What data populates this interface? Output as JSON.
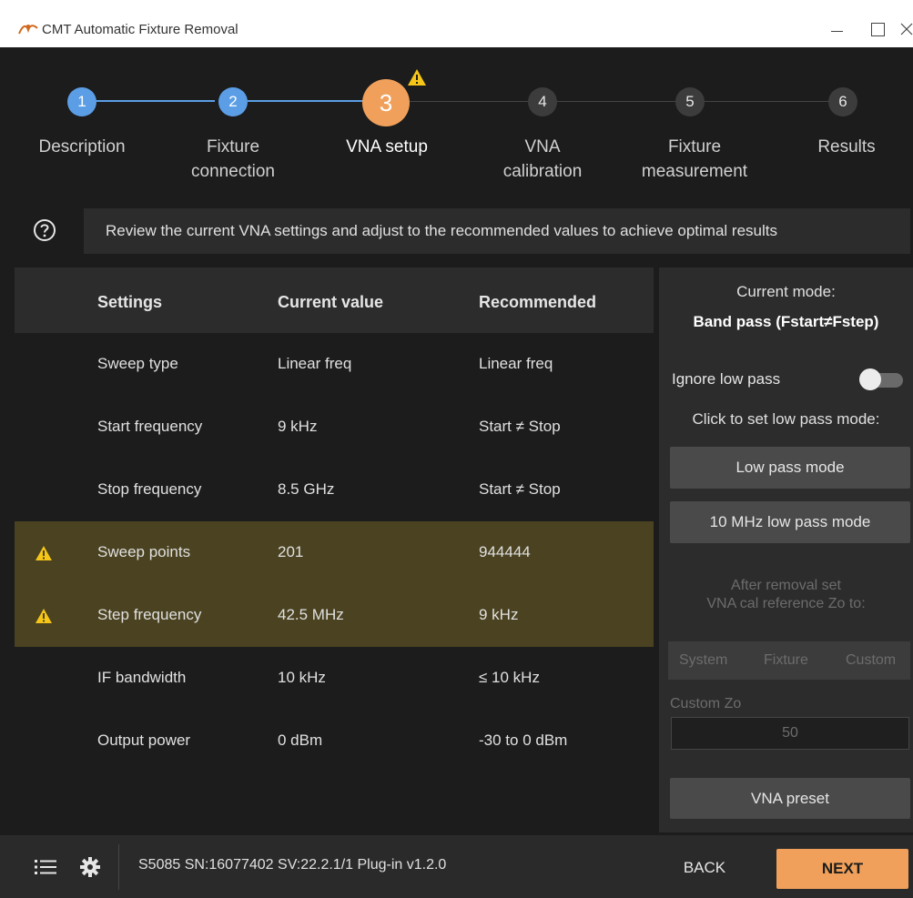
{
  "window": {
    "title": "CMT Automatic Fixture Removal",
    "app_icon": "cmt-logo-icon",
    "controls": [
      "minimize-icon",
      "maximize-icon",
      "close-icon"
    ]
  },
  "stepper": {
    "steps": [
      {
        "number": "1",
        "label_line1": "Description",
        "label_line2": "",
        "state": "done"
      },
      {
        "number": "2",
        "label_line1": "Fixture",
        "label_line2": "connection",
        "state": "done"
      },
      {
        "number": "3",
        "label_line1": "VNA setup",
        "label_line2": "",
        "state": "active"
      },
      {
        "number": "4",
        "label_line1": "VNA",
        "label_line2": "calibration",
        "state": "todo"
      },
      {
        "number": "5",
        "label_line1": "Fixture",
        "label_line2": "measurement",
        "state": "todo"
      },
      {
        "number": "6",
        "label_line1": "Results",
        "label_line2": "",
        "state": "todo"
      }
    ],
    "active_warning_icon": "warning-icon"
  },
  "info": {
    "icon": "help-icon",
    "text": "Review the current VNA settings and adjust to the recommended values to achieve optimal results"
  },
  "table": {
    "headers": {
      "settings": "Settings",
      "current": "Current value",
      "recommended": "Recommended"
    },
    "rows": [
      {
        "setting": "Sweep type",
        "current": "Linear freq",
        "recommended": "Linear freq",
        "warning": false
      },
      {
        "setting": "Start frequency",
        "current": "9 kHz",
        "recommended": "Start ≠ Stop",
        "warning": false
      },
      {
        "setting": "Stop frequency",
        "current": "8.5 GHz",
        "recommended": "Start ≠ Stop",
        "warning": false
      },
      {
        "setting": "Sweep points",
        "current": "201",
        "recommended": "944444",
        "warning": true
      },
      {
        "setting": "Step frequency",
        "current": "42.5 MHz",
        "recommended": "9 kHz",
        "warning": true
      },
      {
        "setting": "IF bandwidth",
        "current": "10 kHz",
        "recommended": "≤ 10 kHz",
        "warning": false
      },
      {
        "setting": "Output power",
        "current": "0 dBm",
        "recommended": "-30 to 0 dBm",
        "warning": false
      }
    ],
    "colors": {
      "warning_row": "#4a4220",
      "warning_icon": "#f5c518"
    }
  },
  "panel": {
    "mode_title": "Current mode:",
    "mode_value": "Band pass (Fstart≠Fstep)",
    "ignore_low_pass_label": "Ignore low pass",
    "ignore_low_pass_on": false,
    "click_label": "Click to set low pass mode:",
    "low_pass_button": "Low pass mode",
    "low_pass_10mhz_button": "10 MHz low pass mode",
    "after_removal_line1": "After removal set",
    "after_removal_line2": "VNA cal reference Zo to:",
    "zo_options": [
      "System",
      "Fixture",
      "Custom"
    ],
    "custom_zo_label": "Custom Zo",
    "custom_zo_value": "50",
    "preset_button": "VNA preset"
  },
  "footer": {
    "menu_icon": "menu-icon",
    "settings_icon": "gear-icon",
    "device_info": "S5085 SN:16077402 SV:22.2.1/1 Plug-in v1.2.0",
    "back_label": "BACK",
    "next_label": "NEXT"
  },
  "colors": {
    "accent": "#f0a05a",
    "done_step": "#5b9ee6",
    "background": "#1c1c1c",
    "panel": "#2c2c2c"
  }
}
